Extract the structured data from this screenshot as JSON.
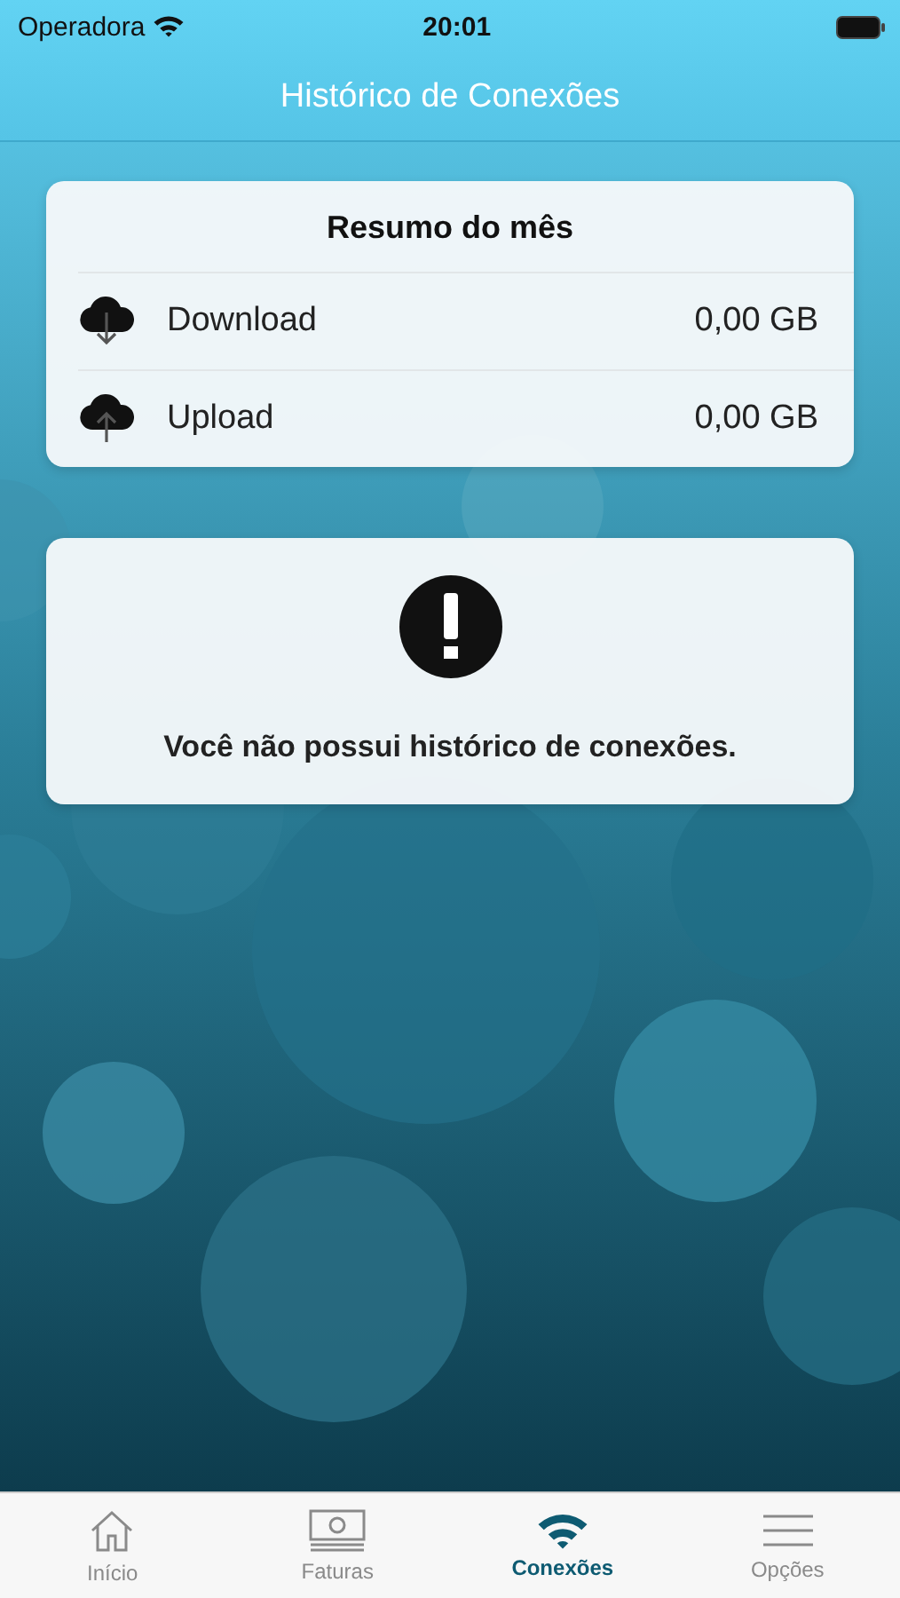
{
  "status_bar": {
    "carrier": "Operadora",
    "time": "20:01"
  },
  "nav_bar": {
    "title": "Histórico de Conexões"
  },
  "summary": {
    "title": "Resumo do mês",
    "rows": [
      {
        "kind": "download",
        "label": "Download",
        "value": "0,00 GB"
      },
      {
        "kind": "upload",
        "label": "Upload",
        "value": "0,00 GB"
      }
    ]
  },
  "empty_state": {
    "message": "Você não possui histórico de conexões."
  },
  "tab_bar": [
    {
      "kind": "home",
      "label": "Início",
      "selected": false
    },
    {
      "kind": "bills",
      "label": "Faturas",
      "selected": false
    },
    {
      "kind": "wifi",
      "label": "Conexões",
      "selected": true
    },
    {
      "kind": "menu",
      "label": "Opções",
      "selected": false
    }
  ]
}
